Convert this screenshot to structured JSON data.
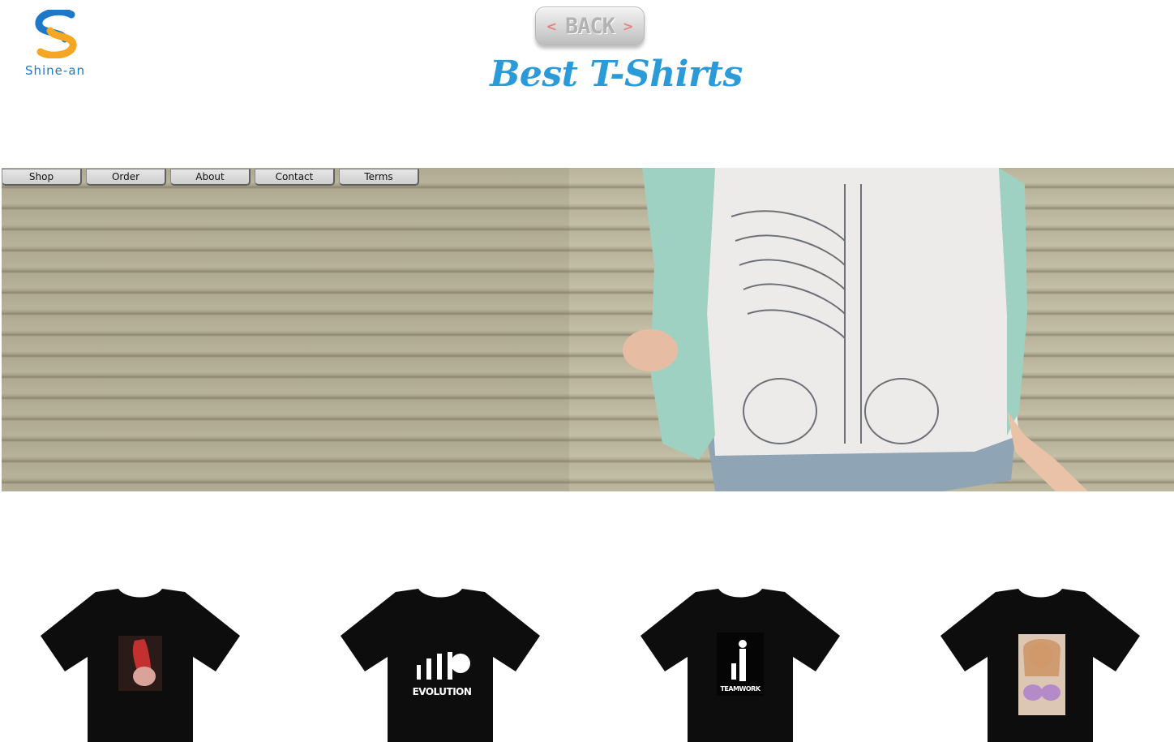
{
  "brand": {
    "name": "Shine-an"
  },
  "back_button": {
    "label": "BACK",
    "left_arrow": "<",
    "right_arrow": ">"
  },
  "page_title": "Best T-Shirts",
  "nav": [
    {
      "label": "Shop"
    },
    {
      "label": "Order"
    },
    {
      "label": "About"
    },
    {
      "label": "Contact"
    },
    {
      "label": "Terms"
    }
  ],
  "products": [
    {
      "print": "red-haired figure photo",
      "print_text": ""
    },
    {
      "print": "evolution silhouette graphic",
      "print_text": "EVOLUTION"
    },
    {
      "print": "teamwork silhouette graphic",
      "print_text": "TEAMWORK"
    },
    {
      "print": "woman photo",
      "print_text": ""
    }
  ],
  "colors": {
    "title": "#2a9ad8",
    "brand_blue": "#1d78c8",
    "brand_orange": "#f5a623",
    "shirt": "#0d0d0d",
    "hero_wall": "#b8b39a"
  }
}
